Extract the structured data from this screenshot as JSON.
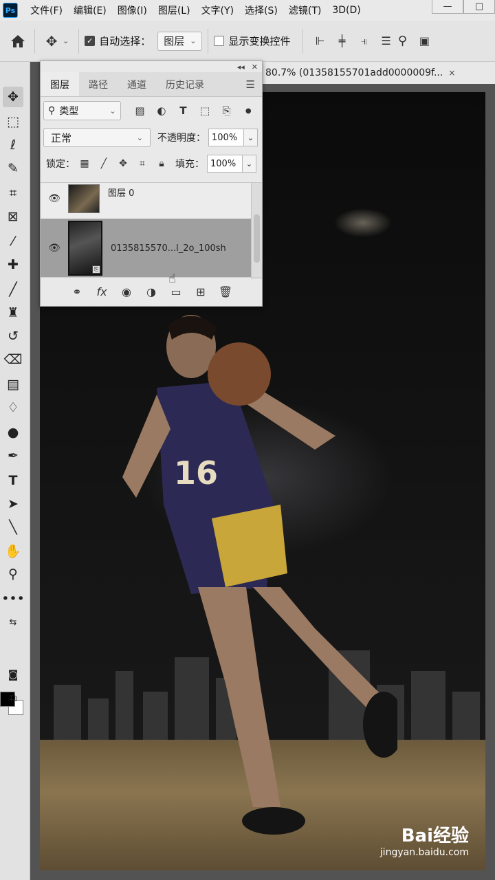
{
  "app": {
    "logo": "Ps"
  },
  "menu": [
    "文件(F)",
    "编辑(E)",
    "图像(I)",
    "图层(L)",
    "文字(Y)",
    "选择(S)",
    "滤镜(T)",
    "3D(D)"
  ],
  "window": {
    "minimize": "—",
    "maximize": "□"
  },
  "options": {
    "auto_select_label": "自动选择：",
    "auto_select_checked": true,
    "auto_select_target": "图层",
    "show_transform_label": "显示变换控件",
    "show_transform_checked": false
  },
  "document": {
    "tab_title": "80.7% (01358155701add0000009f...",
    "close": "×",
    "watermark_logo": "Bai经验",
    "watermark_url": "jingyan.baidu.com"
  },
  "layers_panel": {
    "tabs": [
      "图层",
      "路径",
      "通道",
      "历史记录"
    ],
    "active_tab": "图层",
    "filter_type": "类型",
    "blend_mode": "正常",
    "opacity_label": "不透明度：",
    "opacity": "100%",
    "lock_label": "锁定：",
    "fill_label": "填充：",
    "fill": "100%",
    "layers": [
      {
        "name": "图层 0",
        "visible": true,
        "selected": false
      },
      {
        "name": "0135815570...l_2o_100sh",
        "visible": true,
        "selected": true
      }
    ]
  },
  "tools": [
    "move-tool",
    "marquee-tool",
    "lasso-tool",
    "quick-select-tool",
    "crop-tool",
    "frame-tool",
    "eyedropper-tool",
    "healing-tool",
    "brush-tool",
    "stamp-tool",
    "history-brush-tool",
    "eraser-tool",
    "gradient-tool",
    "blur-tool",
    "dodge-tool",
    "pen-tool",
    "type-tool",
    "path-select-tool",
    "line-tool",
    "hand-tool",
    "zoom-tool",
    "more-tools"
  ],
  "colors": {
    "foreground": "#000000",
    "background": "#ffffff"
  }
}
